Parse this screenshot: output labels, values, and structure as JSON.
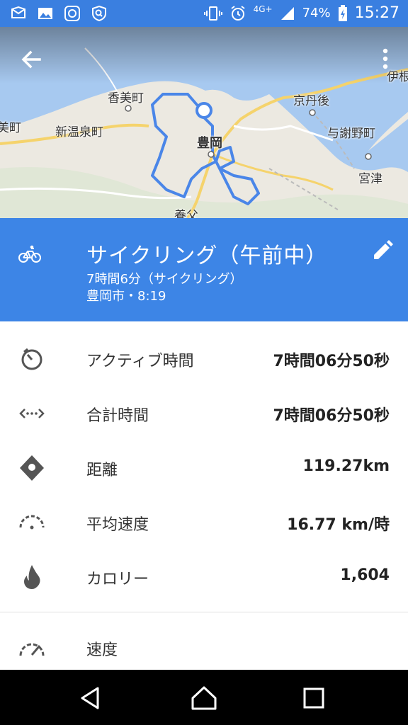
{
  "status_bar": {
    "network": "4G+",
    "battery": "74%",
    "time": "15:27",
    "icons": [
      "mail-icon",
      "image-icon",
      "app-icon",
      "shield-search-icon",
      "vibrate-icon",
      "alarm-icon",
      "signal-icon",
      "battery-charging-icon"
    ]
  },
  "map": {
    "labels": {
      "kasumi": "香美町",
      "shin_onsen": "新温泉町",
      "left_cut": "美町",
      "toyooka": "豊岡",
      "kyotango": "京丹後",
      "yosano": "与謝野町",
      "miyazu": "宮津",
      "ine": "伊根",
      "yabu": "養父"
    },
    "route_color": "#4a86e8"
  },
  "header": {
    "title": "サイクリング（午前中）",
    "duration_line": "7時間6分（サイクリング）",
    "place_time": "豊岡市・8:19",
    "color": "#3d85e6"
  },
  "stats": [
    {
      "icon": "timer-icon",
      "label": "アクティブ時間",
      "value": "7時間06分50秒"
    },
    {
      "icon": "total-time-icon",
      "label": "合計時間",
      "value": "7時間06分50秒"
    },
    {
      "icon": "location-pin-icon",
      "label": "距離",
      "value": "119.27km"
    },
    {
      "icon": "speedometer-icon",
      "label": "平均速度",
      "value": "16.77 km/時"
    },
    {
      "icon": "flame-icon",
      "label": "カロリー",
      "value": "1,604"
    }
  ],
  "speed_section": {
    "label": "速度",
    "icon": "speed-gauge-icon"
  },
  "nav": [
    "back-nav-icon",
    "home-nav-icon",
    "recents-nav-icon"
  ]
}
